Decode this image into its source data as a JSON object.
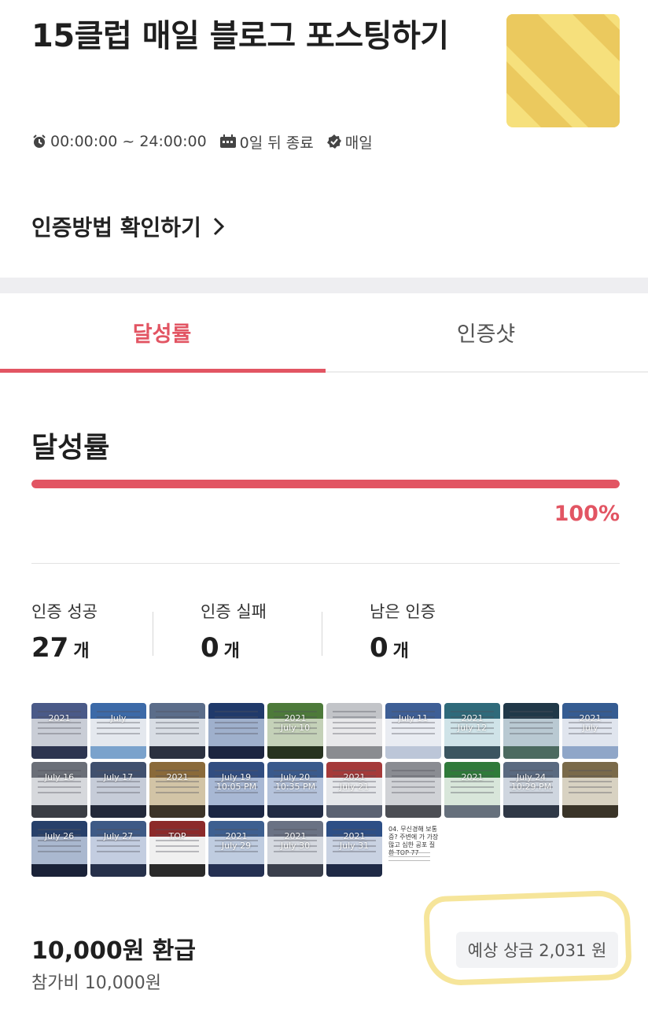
{
  "challenge": {
    "title": "15클럽 매일 블로그 포스팅하기",
    "time_range": "00:00:00 ~ 24:00:00",
    "end_info": "0일 뒤 종료",
    "frequency": "매일",
    "verify_method_label": "인증방법 확인하기"
  },
  "icons": {
    "time": "alarm-clock-icon",
    "end": "calendar-icon",
    "frequency": "verified-badge-icon",
    "chevron": "chevron-right-icon"
  },
  "tabs": [
    {
      "label": "달성률",
      "active": true
    },
    {
      "label": "인증샷",
      "active": false
    }
  ],
  "achievement": {
    "title": "달성률",
    "percent": 100,
    "percent_label": "100%"
  },
  "stats": [
    {
      "label": "인증 성공",
      "value": "27",
      "unit": "개"
    },
    {
      "label": "인증 실패",
      "value": "0",
      "unit": "개"
    },
    {
      "label": "남은 인증",
      "value": "0",
      "unit": "개"
    }
  ],
  "photos": [
    {
      "overlay": "2021"
    },
    {
      "overlay": "July"
    },
    {
      "overlay": ""
    },
    {
      "overlay": ""
    },
    {
      "overlay": "2021\nJuly 10"
    },
    {
      "overlay": ""
    },
    {
      "overlay": "July 11"
    },
    {
      "overlay": "2021\nJuly 12"
    },
    {
      "overlay": ""
    },
    {
      "overlay": "2021\nJuly"
    },
    {
      "overlay": "July 16"
    },
    {
      "overlay": "July 17"
    },
    {
      "overlay": "2021"
    },
    {
      "overlay": "July 19\n10:05 PM"
    },
    {
      "overlay": "July 20\n10:35 PM"
    },
    {
      "overlay": "2021\nJuly 21"
    },
    {
      "overlay": ""
    },
    {
      "overlay": "2021"
    },
    {
      "overlay": "July 24\n10:29 PM"
    },
    {
      "overlay": ""
    },
    {
      "overlay": "July 26"
    },
    {
      "overlay": "July 27"
    },
    {
      "overlay": "TOP"
    },
    {
      "overlay": "2021\nJuly 29"
    },
    {
      "overlay": "2021\nJuly 30"
    },
    {
      "overlay": "2021\nJuly 31"
    },
    {
      "text": "04. 무신경해 보통증? 주변에 가 가장 많고 심한 공포 질환 TOP 77"
    }
  ],
  "refund": {
    "title": "10,000원 환급",
    "fee": "참가비 10,000원",
    "expected_prize": "예상 상금 2,031 원"
  },
  "colors": {
    "accent": "#e25563",
    "highlight": "#f3dc78"
  }
}
